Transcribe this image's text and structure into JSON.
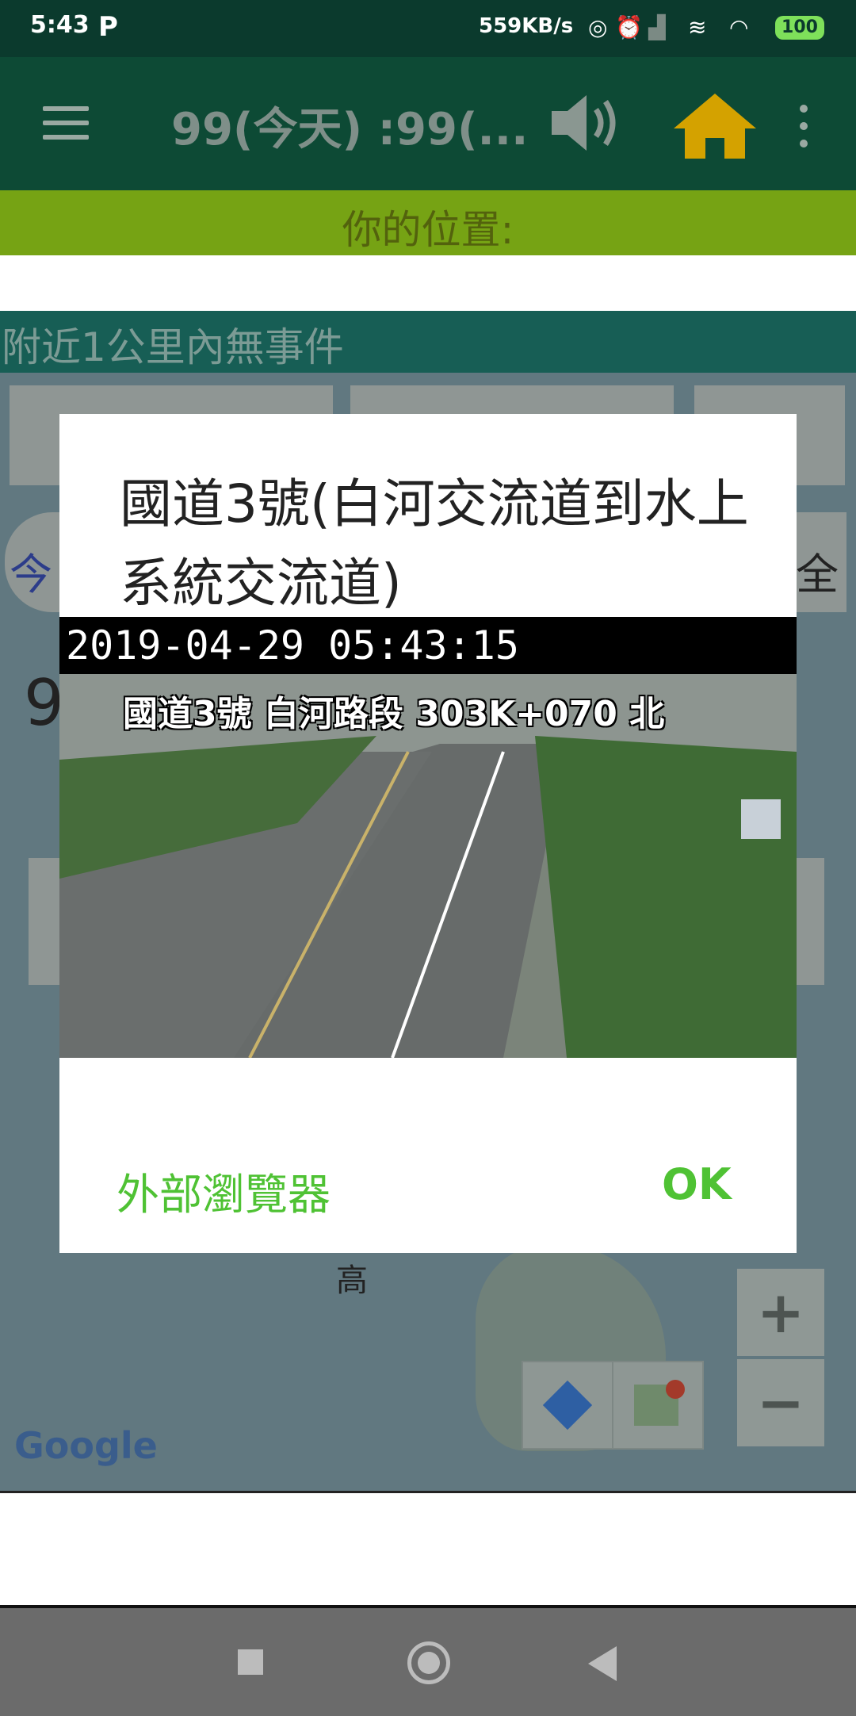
{
  "status_bar": {
    "time": "5:43",
    "p_icon": "P",
    "net_speed": "559KB/s",
    "battery": "100",
    "icons": [
      "hotspot-icon",
      "alarm-icon",
      "signal-icon",
      "wifi-calling-icon",
      "wifi-icon"
    ]
  },
  "app_bar": {
    "title": "99(今天) :99(...",
    "icons": [
      "menu-icon",
      "speaker-icon",
      "home-icon",
      "overflow-menu-icon"
    ],
    "home_color": "#d4a200"
  },
  "location": {
    "label": "你的位置:"
  },
  "event": {
    "text": "附近1公里內無事件"
  },
  "background_map": {
    "partial_texts": [
      "今",
      "全",
      "9",
      "高"
    ],
    "google": "Google",
    "zoom_in": "+",
    "zoom_out": "−"
  },
  "dialog": {
    "title": "國道3號(白河交流道到水上系統交流道)",
    "camera": {
      "timestamp": "2019-04-29  05:43:15",
      "road_label": "國道3號 白河路段 303K+070 北"
    },
    "external_browser": "外部瀏覽器",
    "ok": "OK",
    "accent_color": "#4fc234"
  },
  "nav": [
    "recent-apps-icon",
    "home-nav-icon",
    "back-icon"
  ]
}
